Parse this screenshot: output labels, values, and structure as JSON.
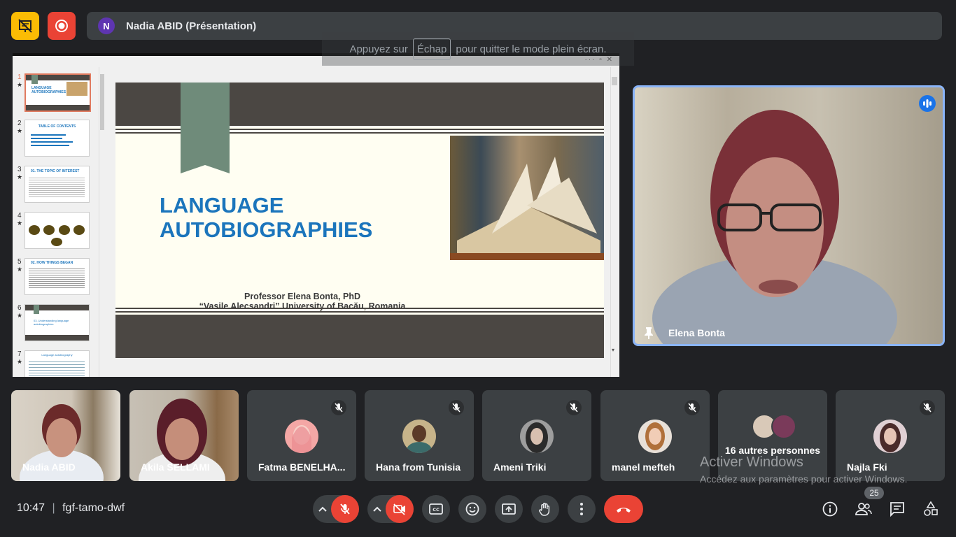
{
  "top": {
    "presenter_initial": "N",
    "presenter_label": "Nadia ABID (Présentation)",
    "esc_before": "Appuyez sur",
    "esc_key": "Échap",
    "esc_after": "pour quitter le mode plein écran."
  },
  "slides_panel": {
    "thumbnails": [
      {
        "num": "1",
        "title": "LANGUAGE AUTOBIOGRAPHIES"
      },
      {
        "num": "2",
        "title": "TABLE OF CONTENTS"
      },
      {
        "num": "3",
        "title": "01. THE TOPIC OF INTEREST"
      },
      {
        "num": "4",
        "title": ""
      },
      {
        "num": "5",
        "title": "02. HOW THINGS BEGAN"
      },
      {
        "num": "6",
        "title": "03. Understanding language autobiographies"
      },
      {
        "num": "7",
        "title": "Language autobiography"
      }
    ]
  },
  "slide": {
    "title_line1": "LANGUAGE",
    "title_line2": "AUTOBIOGRAPHIES",
    "author": "Professor Elena Bonta, PhD",
    "university": "“Vasile Alecsandri” University of Bacău, Romania"
  },
  "speaker": {
    "name": "Elena Bonta"
  },
  "participants": [
    {
      "name": "Nadia ABID",
      "muted": false
    },
    {
      "name": "Akila SELLAMI",
      "muted": false
    },
    {
      "name": "Fatma BENELHA...",
      "muted": true
    },
    {
      "name": "Hana from Tunisia",
      "muted": true
    },
    {
      "name": "Ameni Triki",
      "muted": true
    },
    {
      "name": "manel mefteh",
      "muted": true
    },
    {
      "name": "16 autres personnes",
      "muted": false
    },
    {
      "name": "Najla Fki",
      "muted": true
    }
  ],
  "watermark": {
    "title": "Activer Windows",
    "subtitle": "Accédez aux paramètres pour activer Windows."
  },
  "bottom": {
    "time": "10:47",
    "meeting_code": "fgf-tamo-dwf",
    "people_count": "25"
  },
  "colors": {
    "accent_blue": "#8ab4f8",
    "hangup_red": "#ea4335",
    "yellow_button": "#fbbc04",
    "slide_title_blue": "#1b75bc"
  }
}
